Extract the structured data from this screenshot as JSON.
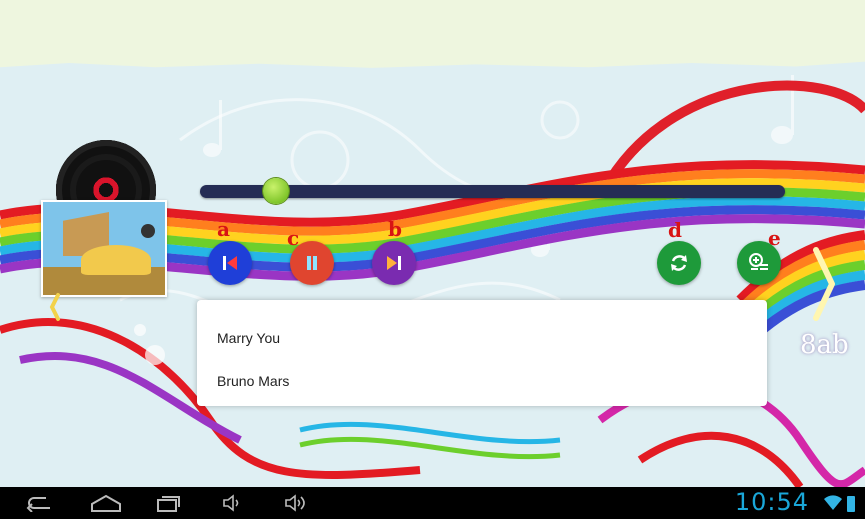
{
  "player": {
    "progress_fraction": 0.13,
    "track_title": "Marry You",
    "artist": "Bruno Mars",
    "controls": [
      {
        "id": "previous",
        "label": "a",
        "color": "#1f3fd8",
        "icon": "skip-previous-icon"
      },
      {
        "id": "pause",
        "label": "c",
        "color": "#e0452f",
        "icon": "pause-icon"
      },
      {
        "id": "next",
        "label": "b",
        "color": "#7a2bb0",
        "icon": "skip-next-icon"
      },
      {
        "id": "repeat",
        "label": "d",
        "color": "#1e9a3a",
        "icon": "repeat-icon"
      },
      {
        "id": "playlist",
        "label": "e",
        "color": "#1e9a3a",
        "icon": "playlist-add-icon"
      }
    ],
    "background_label": "8ab"
  },
  "status_bar": {
    "time": "10:54"
  }
}
